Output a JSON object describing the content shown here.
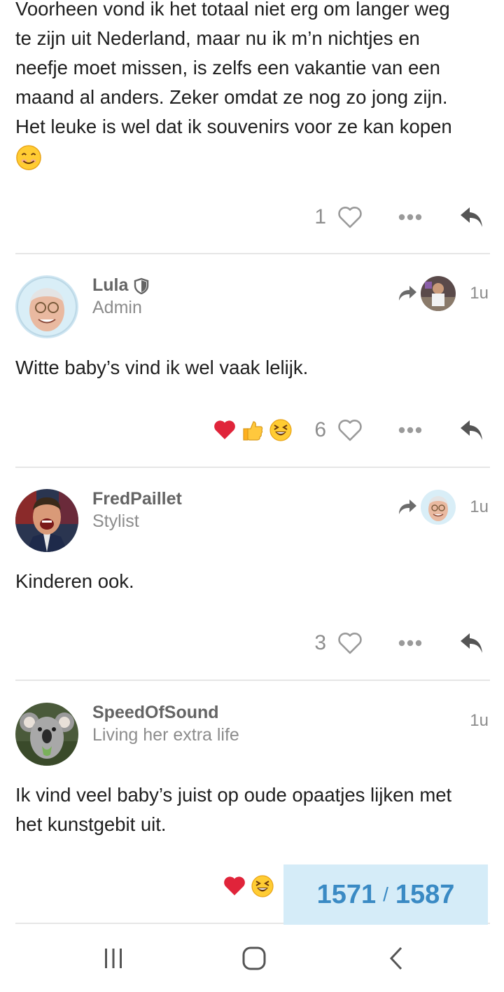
{
  "posts": [
    {
      "text_lines": [
        "Voorheen vond ik het totaal niet erg om langer weg",
        "te zijn uit Nederland, maar nu ik m’n nichtjes en",
        "neefje moet missen, is zelfs een vakantie van een",
        "maand al anders. Zeker omdat ze nog zo jong zijn.",
        "Het leuke is wel dat ik souvenirs voor ze kan kopen"
      ],
      "like_count": "1"
    },
    {
      "username": "Lula",
      "user_title": "Admin",
      "time": "1u",
      "text": "Witte baby’s vind ik wel vaak lelijk.",
      "reactions": [
        "heart",
        "thumbs-up",
        "laughing"
      ],
      "like_count": "6"
    },
    {
      "username": "FredPaillet",
      "user_title": "Stylist",
      "time": "1u",
      "text": "Kinderen ook.",
      "like_count": "3"
    },
    {
      "username": "SpeedOfSound",
      "user_title": "Living her extra life",
      "time": "1u",
      "text_lines": [
        "Ik vind veel baby’s juist op oude opaatjes lijken met",
        "het kunstgebit uit."
      ],
      "reactions": [
        "heart",
        "laughing"
      ]
    }
  ],
  "progress": {
    "current": "1571",
    "separator": "/",
    "total": "1587"
  },
  "colors": {
    "accent": "#3a8ac4",
    "progress_bg": "#d5ecf8",
    "heart_red": "#e0243a",
    "muted": "#8c8c8c"
  },
  "icons": [
    "heart-outline-icon",
    "more-dots-icon",
    "reply-icon",
    "shield-icon",
    "reply-to-arrow-icon",
    "nav-recents-icon",
    "nav-home-icon",
    "nav-back-icon"
  ]
}
